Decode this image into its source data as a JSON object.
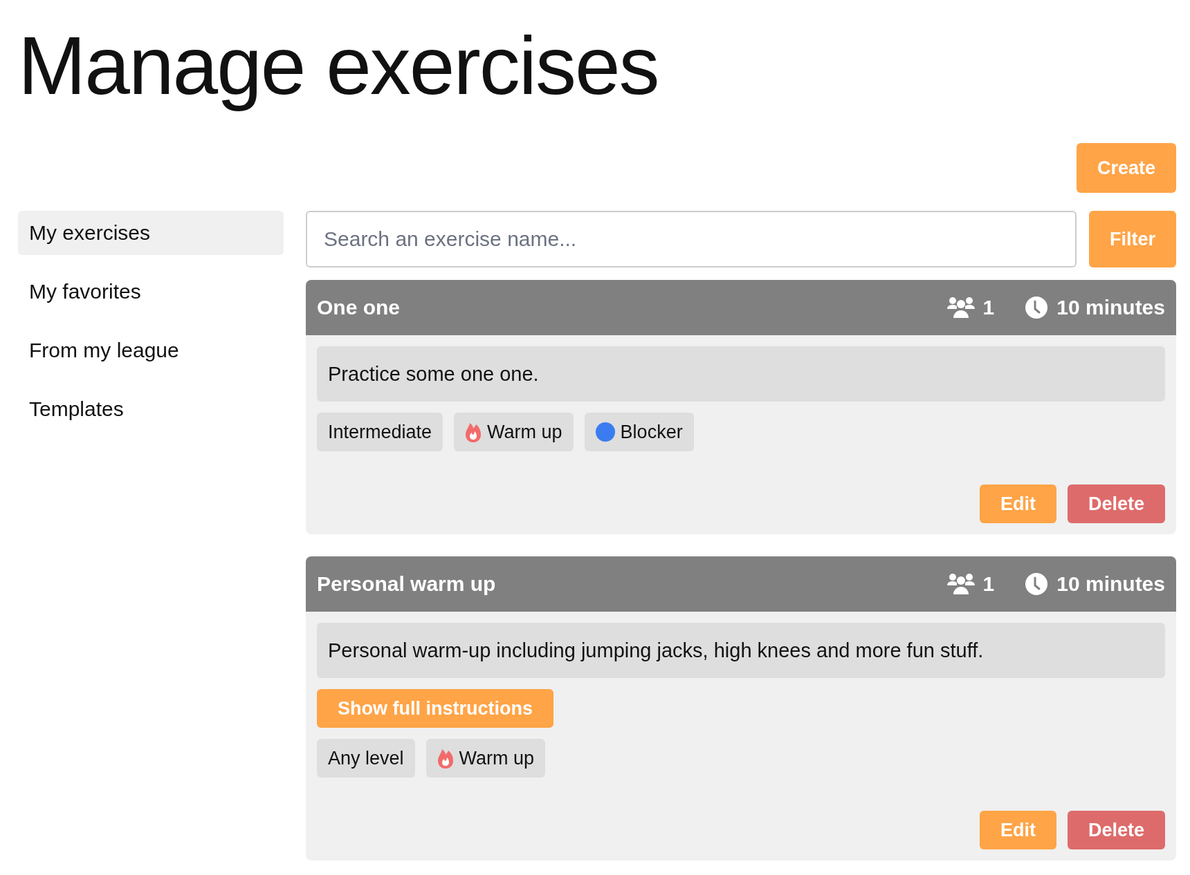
{
  "title": "Manage exercises",
  "create_button": "Create",
  "sidebar": {
    "items": [
      {
        "label": "My exercises",
        "selected": true
      },
      {
        "label": "My favorites",
        "selected": false
      },
      {
        "label": "From my league",
        "selected": false
      },
      {
        "label": "Templates",
        "selected": false
      }
    ]
  },
  "search": {
    "placeholder": "Search an exercise name..."
  },
  "filter_button": "Filter",
  "exercises": [
    {
      "title": "One one",
      "players": "1",
      "duration": "10 minutes",
      "description": "Practice some one one.",
      "tags": [
        {
          "kind": "level",
          "label": "Intermediate"
        },
        {
          "kind": "category",
          "label": "Warm up"
        },
        {
          "kind": "role",
          "label": "Blocker",
          "color": "#3b7cf0"
        }
      ],
      "edit_button": "Edit",
      "delete_button": "Delete"
    },
    {
      "title": "Personal warm up",
      "players": "1",
      "duration": "10 minutes",
      "description": "Personal warm-up including jumping jacks, high knees and more fun stuff.",
      "instructions_button": "Show full instructions",
      "tags": [
        {
          "kind": "level",
          "label": "Any level"
        },
        {
          "kind": "category",
          "label": "Warm up"
        }
      ],
      "edit_button": "Edit",
      "delete_button": "Delete"
    }
  ]
}
